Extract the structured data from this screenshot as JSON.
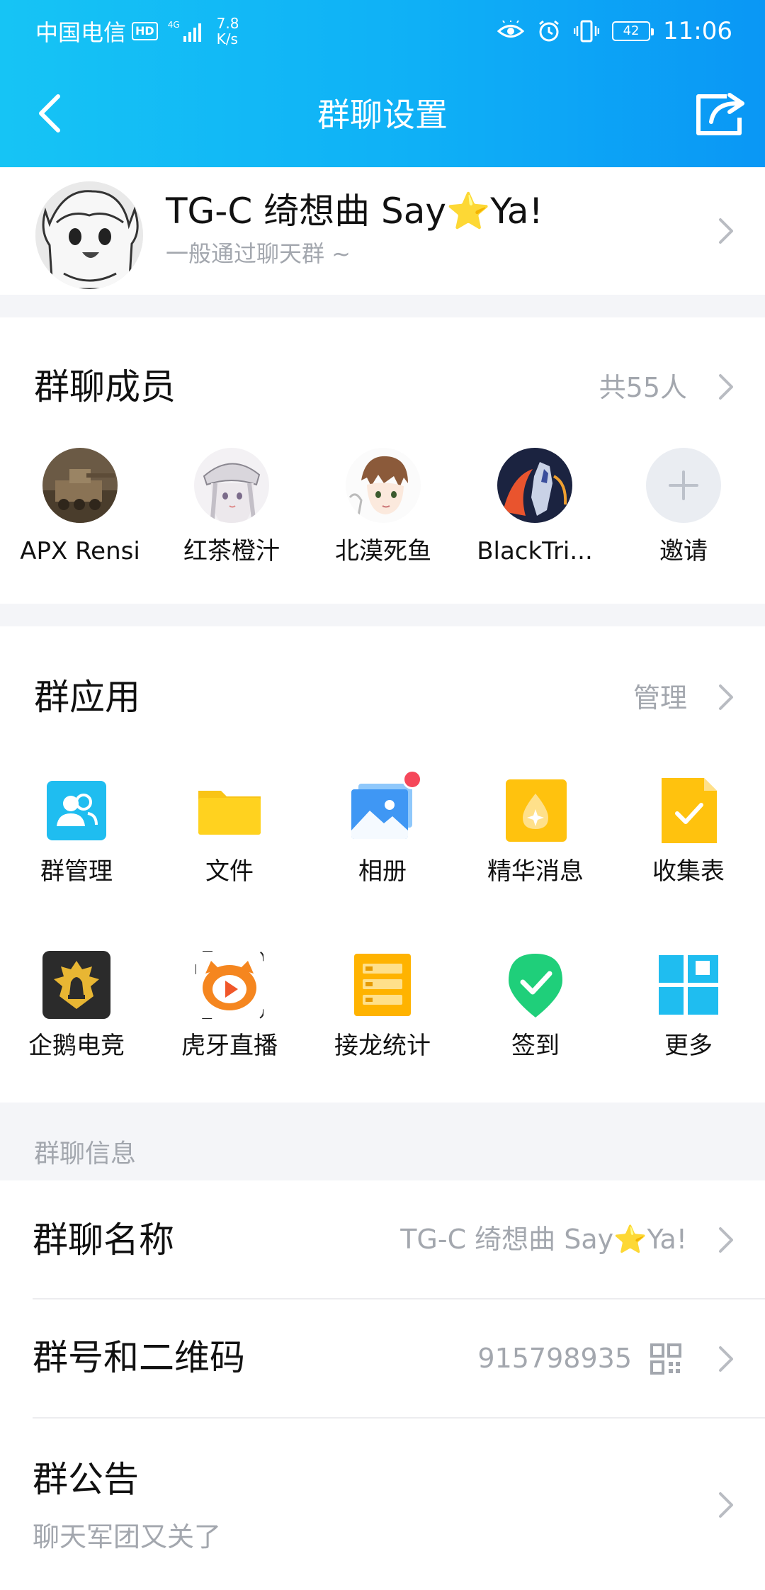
{
  "status_bar": {
    "carrier": "中国电信",
    "hd": "HD",
    "network": "4G",
    "speed_value": "7.8",
    "speed_unit": "K/s",
    "battery": "42",
    "time": "11:06",
    "icons": [
      "eye-icon",
      "alarm-icon",
      "vibrate-icon"
    ]
  },
  "header": {
    "title": "群聊设置",
    "back_icon": "chevron-left-icon",
    "share_icon": "share-icon"
  },
  "group": {
    "name_prefix": "TG-C  绮想曲 Say",
    "name_star": "⭐",
    "name_suffix": "Ya!",
    "description": "一般通过聊天群 ~"
  },
  "members": {
    "title": "群聊成员",
    "count": "共55人",
    "list": [
      {
        "name": "APX Rensi"
      },
      {
        "name": "红茶橙汁"
      },
      {
        "name": "北漠死鱼"
      },
      {
        "name": "BlackTri..."
      }
    ],
    "invite_label": "邀请"
  },
  "apps": {
    "title": "群应用",
    "manage_label": "管理",
    "items": [
      {
        "label": "群管理",
        "icon": "group-manage-icon"
      },
      {
        "label": "文件",
        "icon": "folder-icon"
      },
      {
        "label": "相册",
        "icon": "album-icon",
        "badge": true
      },
      {
        "label": "精华消息",
        "icon": "essence-icon"
      },
      {
        "label": "收集表",
        "icon": "form-icon"
      },
      {
        "label": "企鹅电竞",
        "icon": "esports-icon"
      },
      {
        "label": "虎牙直播",
        "icon": "huya-icon"
      },
      {
        "label": "接龙统计",
        "icon": "relay-icon"
      },
      {
        "label": "签到",
        "icon": "checkin-icon"
      },
      {
        "label": "更多",
        "icon": "more-grid-icon"
      }
    ]
  },
  "info": {
    "section_title": "群聊信息",
    "name_label": "群聊名称",
    "name_value_prefix": "TG-C  绮想曲 Say",
    "name_value_star": "⭐",
    "name_value_suffix": "Ya!",
    "number_label": "群号和二维码",
    "number_value": "915798935",
    "announcement_label": "群公告",
    "announcement_value": "聊天军团又关了"
  },
  "colors": {
    "header_start": "#16c4f5",
    "header_end": "#0a97f5",
    "secondary_text": "#a3a7ae",
    "badge": "#f5475a"
  }
}
